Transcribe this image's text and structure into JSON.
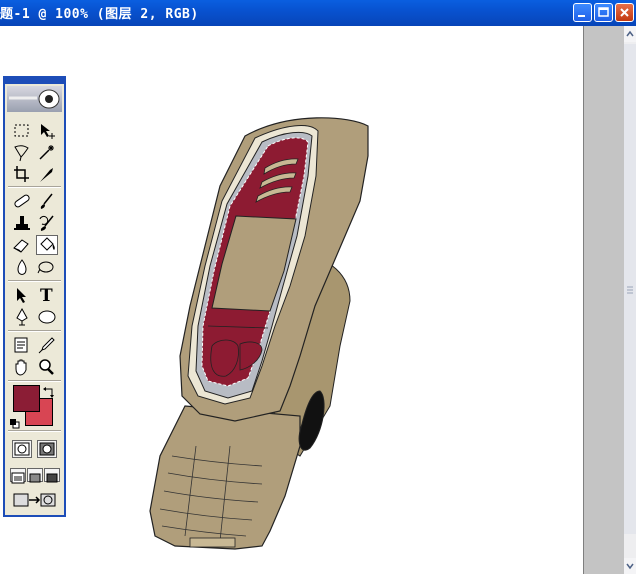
{
  "window": {
    "title": "题-1 @ 100% (图层 2, RGB)"
  },
  "colors": {
    "foreground": "#8b1d35",
    "background": "#d84553",
    "titlebar": "#0852d0",
    "phone_body": "#b09e7b",
    "phone_screen_frame": "#8d1b32",
    "phone_screen": "#b09e7b"
  },
  "toolbox": {
    "tools": [
      "marquee-tool",
      "move-tool",
      "lasso-tool",
      "magic-wand-tool",
      "crop-tool",
      "slice-tool",
      "healing-brush-tool",
      "brush-tool",
      "clone-stamp-tool",
      "history-brush-tool",
      "eraser-tool",
      "paint-bucket-tool",
      "blur-tool",
      "dodge-tool",
      "path-selection-tool",
      "type-tool",
      "pen-tool",
      "shape-tool",
      "notes-tool",
      "eyedropper-tool",
      "hand-tool",
      "zoom-tool"
    ],
    "type_tool_glyph": "T"
  }
}
